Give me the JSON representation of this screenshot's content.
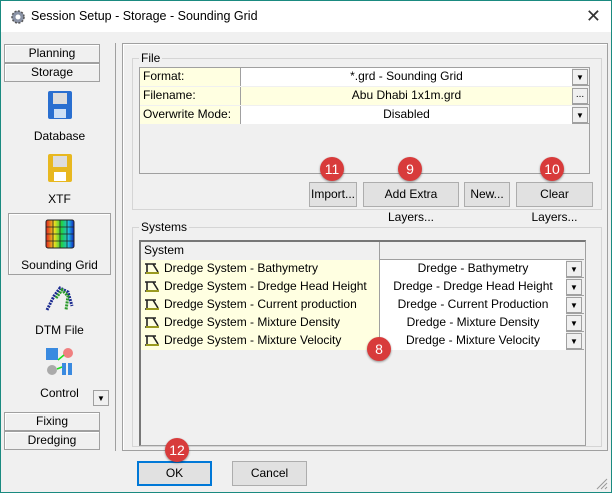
{
  "window": {
    "title": "Session Setup - Storage -  Sounding Grid",
    "close": "✕"
  },
  "nav": {
    "tabs_top": [
      "Planning",
      "Storage"
    ],
    "items": [
      {
        "label": "Database",
        "icon": "floppy-blue-icon"
      },
      {
        "label": "XTF",
        "icon": "floppy-yellow-icon"
      },
      {
        "label": "Sounding Grid",
        "icon": "sounding-grid-icon",
        "selected": true
      },
      {
        "label": "DTM File",
        "icon": "dtm-file-icon"
      },
      {
        "label": "Control",
        "icon": "control-icon"
      }
    ],
    "tabs_bottom": [
      "Fixing",
      "Dredging"
    ]
  },
  "file": {
    "group_label": "File",
    "rows": [
      {
        "label": "Format:",
        "value": "*.grd - Sounding Grid",
        "control": "dropdown"
      },
      {
        "label": "Filename:",
        "value": "Abu Dhabi 1x1m.grd",
        "control": "browse",
        "button": "..."
      },
      {
        "label": "Overwrite Mode:",
        "value": "Disabled",
        "control": "dropdown"
      }
    ],
    "buttons": {
      "import": "Import...",
      "add_layers": "Add Extra Layers...",
      "new": "New...",
      "clear_layers": "Clear Layers..."
    }
  },
  "systems": {
    "group_label": "Systems",
    "header": "System",
    "rows": [
      {
        "system": "Dredge System - Bathymetry",
        "value": "Dredge - Bathymetry"
      },
      {
        "system": "Dredge System - Dredge Head Height",
        "value": "Dredge - Dredge Head Height"
      },
      {
        "system": "Dredge System - Current production",
        "value": "Dredge - Current Production"
      },
      {
        "system": "Dredge System - Mixture Density",
        "value": "Dredge - Mixture Density"
      },
      {
        "system": "Dredge System - Mixture Velocity",
        "value": "Dredge - Mixture Velocity"
      }
    ]
  },
  "footer": {
    "ok": "OK",
    "cancel": "Cancel"
  },
  "badges": {
    "import": "11",
    "add_layers": "9",
    "clear_layers": "10",
    "systems": "8",
    "ok": "12"
  },
  "colors": {
    "badge": "#d83b3b",
    "label_cell": "#ffffe1",
    "border": "#1a8a80"
  }
}
